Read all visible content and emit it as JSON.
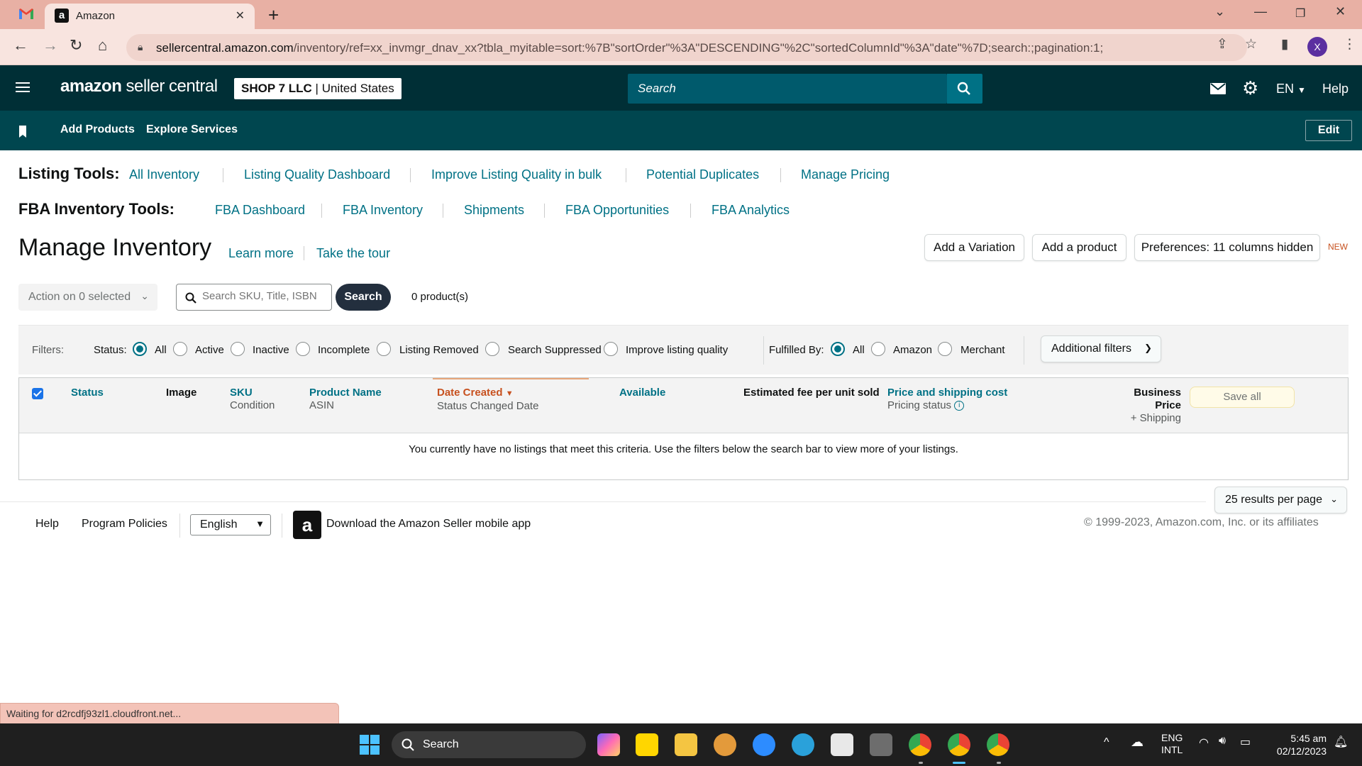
{
  "browser": {
    "tab_title": "Amazon",
    "url_domain": "sellercentral.amazon.com",
    "url_path": "/inventory/ref=xx_invmgr_dnav_xx?tbla_myitable=sort:%7B\"sortOrder\"%3A\"DESCENDING\"%2C\"sortedColumnId\"%3A\"date\"%7D;search:;pagination:1;",
    "profile_initial": "X"
  },
  "header": {
    "logo_brand": "amazon",
    "logo_product": "seller central",
    "store_name": "SHOP 7 LLC",
    "store_region": "United States",
    "search_placeholder": "Search",
    "language": "EN",
    "help": "Help"
  },
  "subnav": {
    "items": [
      "Add Products",
      "Explore Services"
    ],
    "edit": "Edit"
  },
  "listing_tools": {
    "label": "Listing Tools:",
    "links": [
      "All Inventory",
      "Listing Quality Dashboard",
      "Improve Listing Quality in bulk",
      "Potential Duplicates",
      "Manage Pricing"
    ]
  },
  "fba_tools": {
    "label": "FBA Inventory Tools:",
    "links": [
      "FBA Dashboard",
      "FBA Inventory",
      "Shipments",
      "FBA Opportunities",
      "FBA Analytics"
    ]
  },
  "page": {
    "title": "Manage Inventory",
    "learn_more": "Learn more",
    "take_tour": "Take the tour",
    "add_variation": "Add a Variation",
    "add_product": "Add a product",
    "preferences": "Preferences: 11 columns hidden",
    "new_badge": "NEW"
  },
  "actions": {
    "action_select": "Action on 0 selected",
    "search_placeholder": "Search SKU, Title, ISBN",
    "search_button": "Search",
    "product_count": "0 product(s)"
  },
  "filters": {
    "label": "Filters:",
    "status_label": "Status:",
    "status_options": [
      "All",
      "Active",
      "Inactive",
      "Incomplete",
      "Listing Removed",
      "Search Suppressed",
      "Improve listing quality"
    ],
    "status_selected": "All",
    "fulfilled_label": "Fulfilled By:",
    "fulfilled_options": [
      "All",
      "Amazon",
      "Merchant"
    ],
    "fulfilled_selected": "All",
    "additional": "Additional filters"
  },
  "table": {
    "columns": {
      "status": "Status",
      "image": "Image",
      "sku": "SKU",
      "condition": "Condition",
      "product_name": "Product Name",
      "asin": "ASIN",
      "date_created": "Date Created",
      "status_changed": "Status Changed Date",
      "available": "Available",
      "est_fee": "Estimated fee per unit sold",
      "price_shipping": "Price and shipping cost",
      "pricing_status": "Pricing status",
      "business_price": "Business Price",
      "plus_shipping": "+ Shipping"
    },
    "save_all": "Save all",
    "empty_message": "You currently have no listings that meet this criteria. Use the filters below the search bar to view more of your listings.",
    "per_page": "25 results per page"
  },
  "footer": {
    "help": "Help",
    "program_policies": "Program Policies",
    "language": "English",
    "download_app": "Download the Amazon Seller mobile app",
    "copyright": "© 1999-2023, Amazon.com, Inc. or its affiliates"
  },
  "status_bar": "Waiting for d2rcdfj93zl1.cloudfront.net...",
  "taskbar": {
    "search": "Search",
    "lang_line1": "ENG",
    "lang_line2": "INTL",
    "time": "5:45 am",
    "date": "02/12/2023"
  },
  "colors": {
    "header_bg": "#002f36",
    "subnav_bg": "#00464f",
    "link": "#007185",
    "sorted": "#c7511f",
    "radio_on": "#007185"
  }
}
